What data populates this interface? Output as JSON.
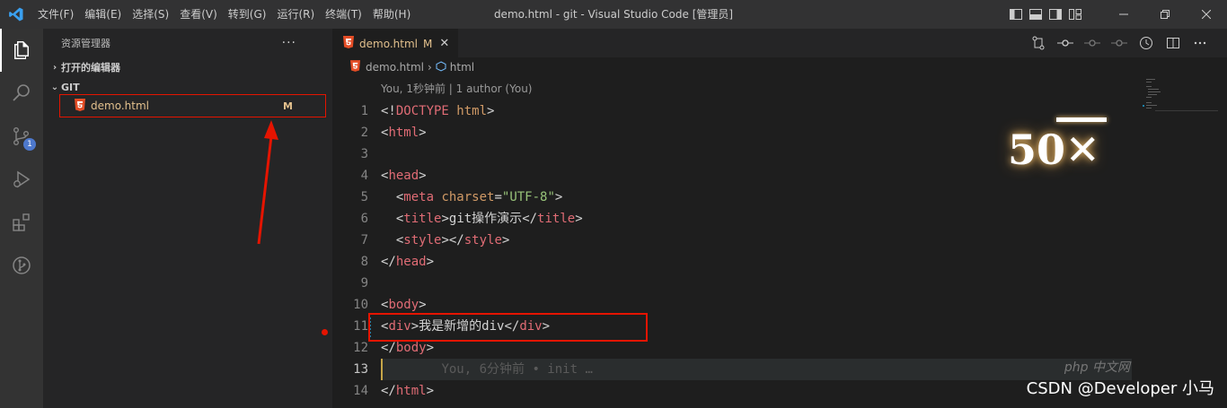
{
  "menu": [
    "文件(F)",
    "编辑(E)",
    "选择(S)",
    "查看(V)",
    "转到(G)",
    "运行(R)",
    "终端(T)",
    "帮助(H)"
  ],
  "window": {
    "title": "demo.html - git - Visual Studio Code [管理员]"
  },
  "activity": {
    "scm_badge": "1"
  },
  "sidebar": {
    "title": "资源管理器",
    "more": "···",
    "open_editors": "打开的编辑器",
    "folder": "GIT",
    "file": {
      "name": "demo.html",
      "status": "M"
    }
  },
  "tab": {
    "label": "demo.html",
    "status": "M",
    "close": "✕"
  },
  "breadcrumb": {
    "file": "demo.html",
    "symbol": "html"
  },
  "codelens": "You, 1秒钟前 | 1 author (You)",
  "line_numbers": [
    "1",
    "2",
    "3",
    "4",
    "5",
    "6",
    "7",
    "8",
    "9",
    "10",
    "11",
    "12",
    "13",
    "14"
  ],
  "code": {
    "l1_lt": "<!",
    "l1_tag": "DOCTYPE",
    "l1_attr": " html",
    "l1_gt": ">",
    "l2": "html",
    "l4": "head",
    "l5_tag": "meta",
    "l5_attr": " charset",
    "l5_eq": "=",
    "l5_val": "\"UTF-8\"",
    "l6_tag": "title",
    "l6_text": "git操作演示",
    "l7_tag": "style",
    "l8": "head",
    "l10": "body",
    "l11_tag": "div",
    "l11_text": "我是新增的div",
    "l12": "body",
    "l13_ghost": "You, 6分钟前 • init …",
    "l14": "html"
  },
  "overlay": {
    "number": "50",
    "symbol": "✕"
  },
  "watermark": "CSDN @Developer 小马",
  "php_logo": "php 中文网",
  "colors": {
    "accent_red": "#e51400",
    "modified": "#e2c08d",
    "tag": "#e06c75",
    "attr": "#d19a66",
    "string": "#98c379"
  }
}
